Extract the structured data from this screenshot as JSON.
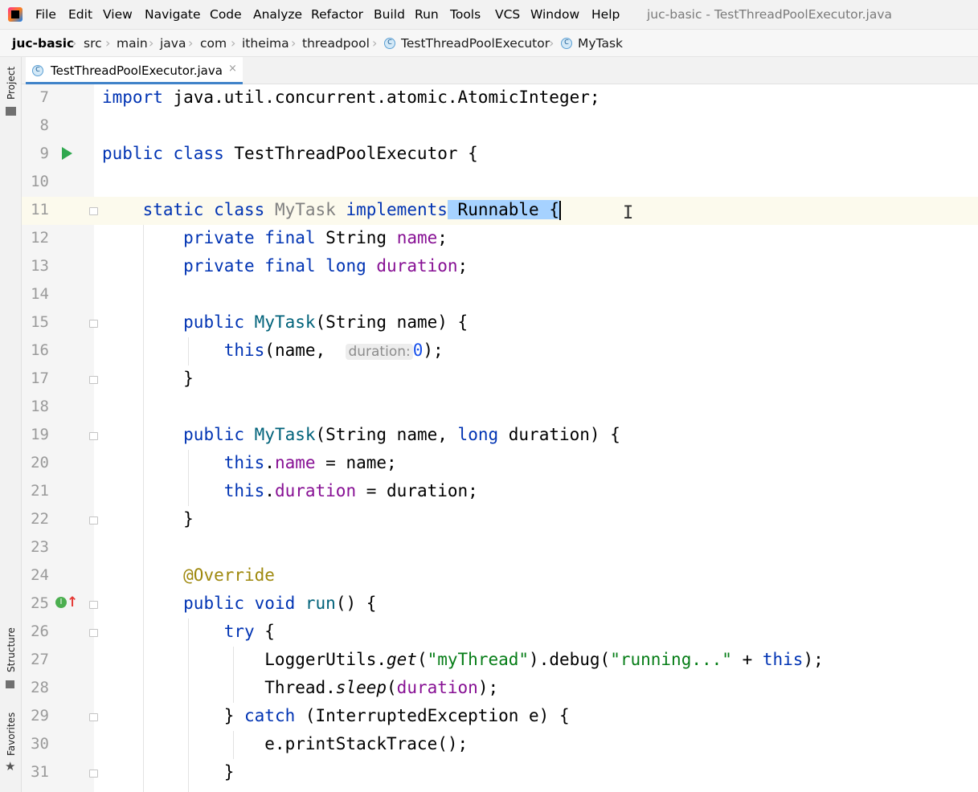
{
  "menubar": {
    "items": [
      "File",
      "Edit",
      "View",
      "Navigate",
      "Code",
      "Analyze",
      "Refactor",
      "Build",
      "Run",
      "Tools",
      "VCS",
      "Window",
      "Help"
    ],
    "window_title": "juc-basic - TestThreadPoolExecutor.java"
  },
  "breadcrumbs": {
    "project": "juc-basic",
    "items": [
      "src",
      "main",
      "java",
      "com",
      "itheima",
      "threadpool"
    ],
    "class": "TestThreadPoolExecutor",
    "inner_class": "MyTask"
  },
  "tool_windows": {
    "project": "Project",
    "structure": "Structure",
    "favorites": "Favorites"
  },
  "tab": {
    "label": "TestThreadPoolExecutor.java",
    "close": "×"
  },
  "editor": {
    "line_numbers": [
      "7",
      "8",
      "9",
      "10",
      "11",
      "12",
      "13",
      "14",
      "15",
      "16",
      "17",
      "18",
      "19",
      "20",
      "21",
      "22",
      "23",
      "24",
      "25",
      "26",
      "27",
      "28",
      "29",
      "30",
      "31"
    ],
    "inlay_hint": "duration:",
    "active_line": 11
  },
  "colors": {
    "keyword": "#0033b3",
    "method": "#00627a",
    "field": "#871094",
    "string": "#067d17",
    "number": "#1750eb",
    "annotation": "#9e880d",
    "selection": "#a6d2ff",
    "tab_underline": "#4083c9",
    "run_icon": "#2fa84f"
  },
  "icons": [
    "intellij-logo-icon",
    "class-icon",
    "run-gutter-icon",
    "implements-gutter-icon",
    "folder-icon",
    "structure-icon",
    "star-icon",
    "close-icon",
    "text-cursor-icon"
  ]
}
